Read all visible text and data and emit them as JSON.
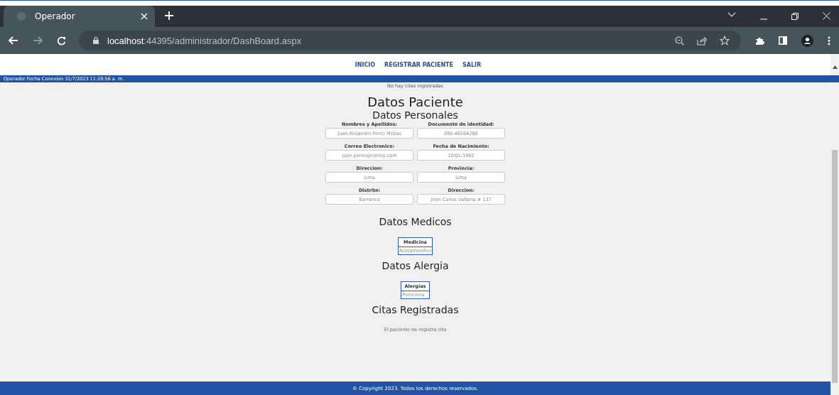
{
  "browser": {
    "tab": {
      "title": "Operador",
      "selected": true
    },
    "address": {
      "host": "localhost",
      "path": ":44395/administrador/DashBoard.aspx"
    }
  },
  "nav": [
    "INICIO",
    "REGISTRAR PACIENTE",
    "SALIR"
  ],
  "status_bar": "Operador Fecha Conexion 31/7/2023 11:28:56 a. m.",
  "notice": "No hay citas registradas",
  "title": "Datos Paciente",
  "personal": {
    "heading": "Datos Personales",
    "fields": [
      {
        "label": "Nombres y Apellidos:",
        "value": "Juan Alejandro Perez Mejias"
      },
      {
        "label": "Documento de identidad:",
        "value": "DNI-46564288"
      },
      {
        "label": "Correo Electronico:",
        "value": "juan.perez@correo.com"
      },
      {
        "label": "Fecha de Nacimiento:",
        "value": "10/01/1962"
      },
      {
        "label": "Direccion:",
        "value": "Lima"
      },
      {
        "label": "Provincia:",
        "value": "Lima"
      },
      {
        "label": "Distrito:",
        "value": "Barranco"
      },
      {
        "label": "Direccion:",
        "value": "Jiron Carlos Vallarta # 137"
      }
    ]
  },
  "medical": {
    "heading": "Datos Medicos",
    "column": "Medicina",
    "rows": [
      "Acetaminofen"
    ]
  },
  "allergy": {
    "heading": "Datos Alergia",
    "column": "Alergias",
    "rows": [
      "Penicilina"
    ]
  },
  "appointments": {
    "heading": "Citas Registradas",
    "empty": "El paciente no registra cita"
  },
  "footer": "© Copyright 2023. Todos los derechos reservados."
}
